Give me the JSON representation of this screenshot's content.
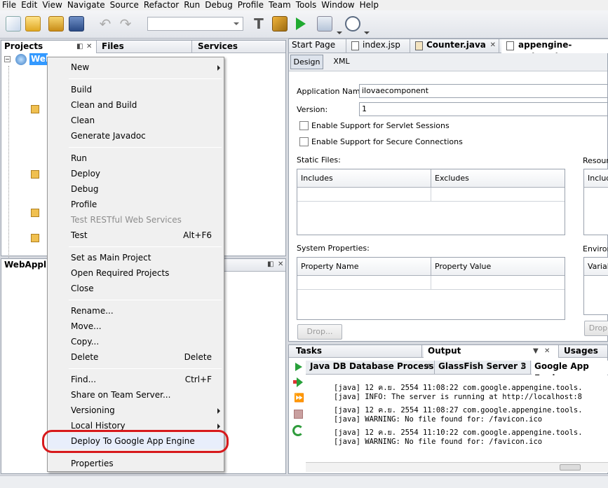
{
  "menubar": [
    "File",
    "Edit",
    "View",
    "Navigate",
    "Source",
    "Refactor",
    "Run",
    "Debug",
    "Profile",
    "Team",
    "Tools",
    "Window",
    "Help"
  ],
  "left_tabs": {
    "projects": "Projects",
    "files": "Files",
    "services": "Services"
  },
  "tree": {
    "root_label": "WebApp"
  },
  "nav_panel": {
    "title": "WebApplic"
  },
  "context_menu": [
    {
      "label": "New",
      "submenu": true
    },
    {
      "label": "Build"
    },
    {
      "label": "Clean and Build"
    },
    {
      "label": "Clean"
    },
    {
      "label": "Generate Javadoc"
    },
    {
      "label": "Run"
    },
    {
      "label": "Deploy"
    },
    {
      "label": "Debug"
    },
    {
      "label": "Profile"
    },
    {
      "label": "Test RESTful Web Services",
      "disabled": true
    },
    {
      "label": "Test",
      "shortcut": "Alt+F6"
    },
    {
      "label": "Set as Main Project"
    },
    {
      "label": "Open Required Projects"
    },
    {
      "label": "Close"
    },
    {
      "label": "Rename..."
    },
    {
      "label": "Move..."
    },
    {
      "label": "Copy..."
    },
    {
      "label": "Delete",
      "shortcut": "Delete"
    },
    {
      "label": "Find...",
      "shortcut": "Ctrl+F"
    },
    {
      "label": "Share on Team Server..."
    },
    {
      "label": "Versioning",
      "submenu": true
    },
    {
      "label": "Local History",
      "submenu": true
    },
    {
      "label": "Deploy To Google App Engine",
      "highlighted": true
    },
    {
      "label": "Properties"
    }
  ],
  "editor_tabs": [
    "Start Page",
    "index.jsp",
    "Counter.java",
    "appengine-web.xml"
  ],
  "view_tabs": {
    "design": "Design",
    "xml": "XML"
  },
  "form": {
    "app_name_label": "Application Name:",
    "app_name_value": "ilovaecomponent",
    "version_label": "Version:",
    "version_value": "1",
    "sessions_label": "Enable Support for Servlet Sessions",
    "secure_label": "Enable Support for Secure Connections",
    "static_files_label": "Static Files:",
    "includes_header": "Includes",
    "excludes_header": "Excludes",
    "resource_label": "Resour",
    "resource_includes": "Includ",
    "system_props_label": "System Properties:",
    "prop_name_header": "Property Name",
    "prop_value_header": "Property Value",
    "environ_label": "Environ",
    "variab_header": "Variab",
    "drop_button": "Drop...",
    "drop_button_right": "Drop"
  },
  "bottom_tabs": {
    "tasks": "Tasks",
    "output": "Output",
    "usages": "Usages"
  },
  "output_tabs": [
    "Java DB Database Process",
    "GlassFish Server 3",
    "Google App Engine"
  ],
  "output_lines": [
    "[java] 12 ค.ย. 2554 11:08:22 com.google.appengine.tools.",
    "[java] INFO: The server is running at http://localhost:8",
    "[java] 12 ค.ย. 2554 11:08:27 com.google.appengine.tools.",
    "[java] WARNING: No file found for: /favicon.ico",
    "[java] 12 ค.ย. 2554 11:10:22 com.google.appengine.tools.",
    "[java] WARNING: No file found for: /favicon.ico"
  ],
  "colors": {
    "highlight_oval": "#d7191c",
    "selection": "#3399ff"
  }
}
